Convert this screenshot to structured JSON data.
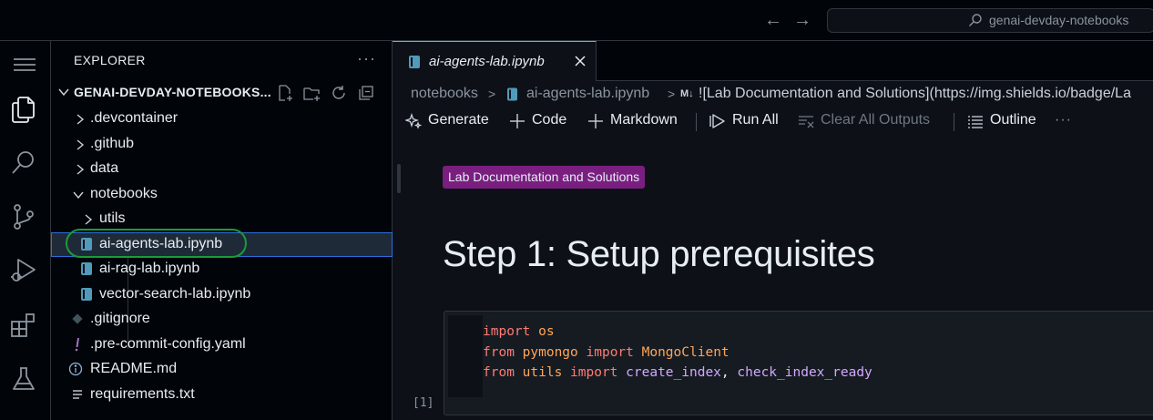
{
  "titlebar": {
    "back": "←",
    "forward": "→",
    "search_text": "genai-devday-notebooks"
  },
  "sidebar": {
    "title": "EXPLORER",
    "more": "···",
    "folder": "GENAI-DEVDAY-NOTEBOOKS...",
    "items": [
      {
        "label": ".devcontainer",
        "type": "folder",
        "expanded": false
      },
      {
        "label": ".github",
        "type": "folder",
        "expanded": false
      },
      {
        "label": "data",
        "type": "folder",
        "expanded": false
      },
      {
        "label": "notebooks",
        "type": "folder",
        "expanded": true
      },
      {
        "label": "utils",
        "type": "folder",
        "expanded": false
      },
      {
        "label": "ai-agents-lab.ipynb",
        "type": "notebook",
        "selected": true
      },
      {
        "label": "ai-rag-lab.ipynb",
        "type": "notebook"
      },
      {
        "label": "vector-search-lab.ipynb",
        "type": "notebook"
      },
      {
        "label": ".gitignore",
        "type": "git"
      },
      {
        "label": ".pre-commit-config.yaml",
        "type": "yaml"
      },
      {
        "label": "README.md",
        "type": "info"
      },
      {
        "label": "requirements.txt",
        "type": "text"
      }
    ]
  },
  "editor": {
    "tab_label": "ai-agents-lab.ipynb",
    "breadcrumb": {
      "part1": "notebooks",
      "sep": ">",
      "part2": "ai-agents-lab.ipynb",
      "md_marker": "M↓",
      "part3": "![Lab Documentation and Solutions](https://img.shields.io/badge/La"
    },
    "toolbar": {
      "generate": "Generate",
      "code": "Code",
      "markdown": "Markdown",
      "run_all": "Run All",
      "clear_outputs": "Clear All Outputs",
      "outline": "Outline",
      "more": "···"
    },
    "badge": "Lab Documentation and Solutions",
    "heading": "Step 1: Setup prerequisites",
    "code": {
      "line1": {
        "kw1": "import",
        "mod1": " os"
      },
      "line2": {
        "kw1": "from",
        "mod1": " pymongo ",
        "kw2": "import",
        "mod2": " MongoClient"
      },
      "line3": {
        "kw1": "from",
        "mod1": " utils ",
        "kw2": "import",
        "fn1": " create_index",
        "punct": ",",
        "fn2": " check_index_ready"
      },
      "exec_count": "[1]"
    }
  },
  "colors": {
    "accent_tab": "#f78166",
    "selection_outline": "#2f6fd8",
    "highlight_ring": "#1a9c3a",
    "badge_bg": "#7a1f80"
  }
}
